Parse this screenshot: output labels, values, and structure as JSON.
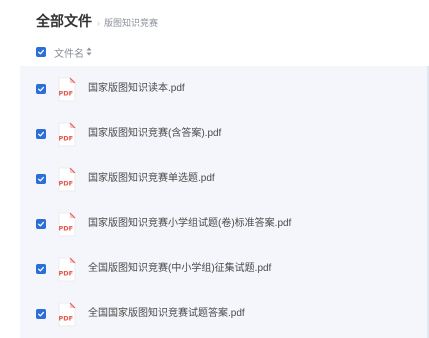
{
  "breadcrumb": {
    "title": "全部文件",
    "separator": "›",
    "current": "版图知识竞赛"
  },
  "list_header": {
    "column_label": "文件名",
    "sort_icon": "sort-icon",
    "select_all_checked": true
  },
  "colors": {
    "accent": "#2a6ed6",
    "pdf_red": "#e2574c"
  },
  "files": [
    {
      "name": "国家版图知识读本.pdf",
      "checked": true,
      "type_badge": "PDF"
    },
    {
      "name": "国家版图知识竞赛(含答案).pdf",
      "checked": true,
      "type_badge": "PDF"
    },
    {
      "name": "国家版图知识竞赛单选题.pdf",
      "checked": true,
      "type_badge": "PDF"
    },
    {
      "name": "国家版图知识竞赛小学组试题(卷)标准答案.pdf",
      "checked": true,
      "type_badge": "PDF"
    },
    {
      "name": "全国版图知识竞赛(中小学组)征集试题.pdf",
      "checked": true,
      "type_badge": "PDF"
    },
    {
      "name": "全国国家版图知识竞赛试题答案.pdf",
      "checked": true,
      "type_badge": "PDF"
    }
  ]
}
